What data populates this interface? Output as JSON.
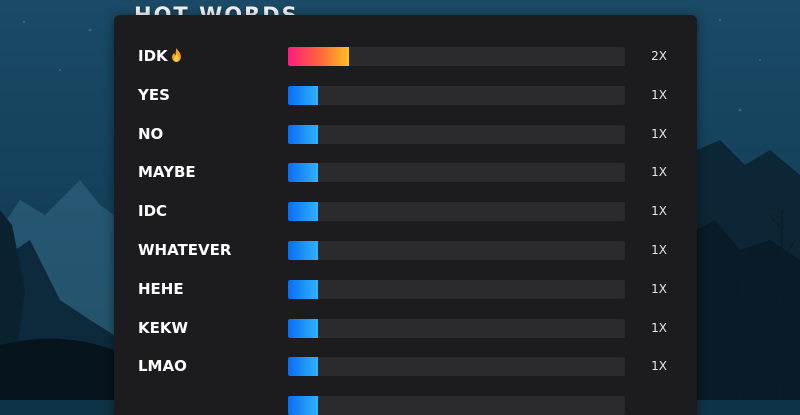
{
  "title": "HOT WORDS",
  "colors": {
    "panel": "#1c1c1e",
    "track": "#2b2b2d",
    "hot_start": "#ff1b7c",
    "hot_end": "#ffc021",
    "bar_start": "#0b6df2",
    "bar_end": "#2fb2ff"
  },
  "words": [
    {
      "word": "IDK",
      "icon": "fire-icon",
      "count": "2X",
      "level": 0.18,
      "style": "hot"
    },
    {
      "word": "YES",
      "count": "1X",
      "level": 0.09,
      "style": "normal"
    },
    {
      "word": "NO",
      "count": "1X",
      "level": 0.09,
      "style": "normal"
    },
    {
      "word": "MAYBE",
      "count": "1X",
      "level": 0.09,
      "style": "normal"
    },
    {
      "word": "IDC",
      "count": "1X",
      "level": 0.09,
      "style": "normal"
    },
    {
      "word": "WHATEVER",
      "count": "1X",
      "level": 0.09,
      "style": "normal"
    },
    {
      "word": "HEHE",
      "count": "1X",
      "level": 0.09,
      "style": "normal"
    },
    {
      "word": "KEKW",
      "count": "1X",
      "level": 0.09,
      "style": "normal"
    },
    {
      "word": "LMAO",
      "count": "1X",
      "level": 0.09,
      "style": "normal"
    },
    {
      "word": "",
      "count": "",
      "level": 0.09,
      "style": "normal"
    }
  ]
}
